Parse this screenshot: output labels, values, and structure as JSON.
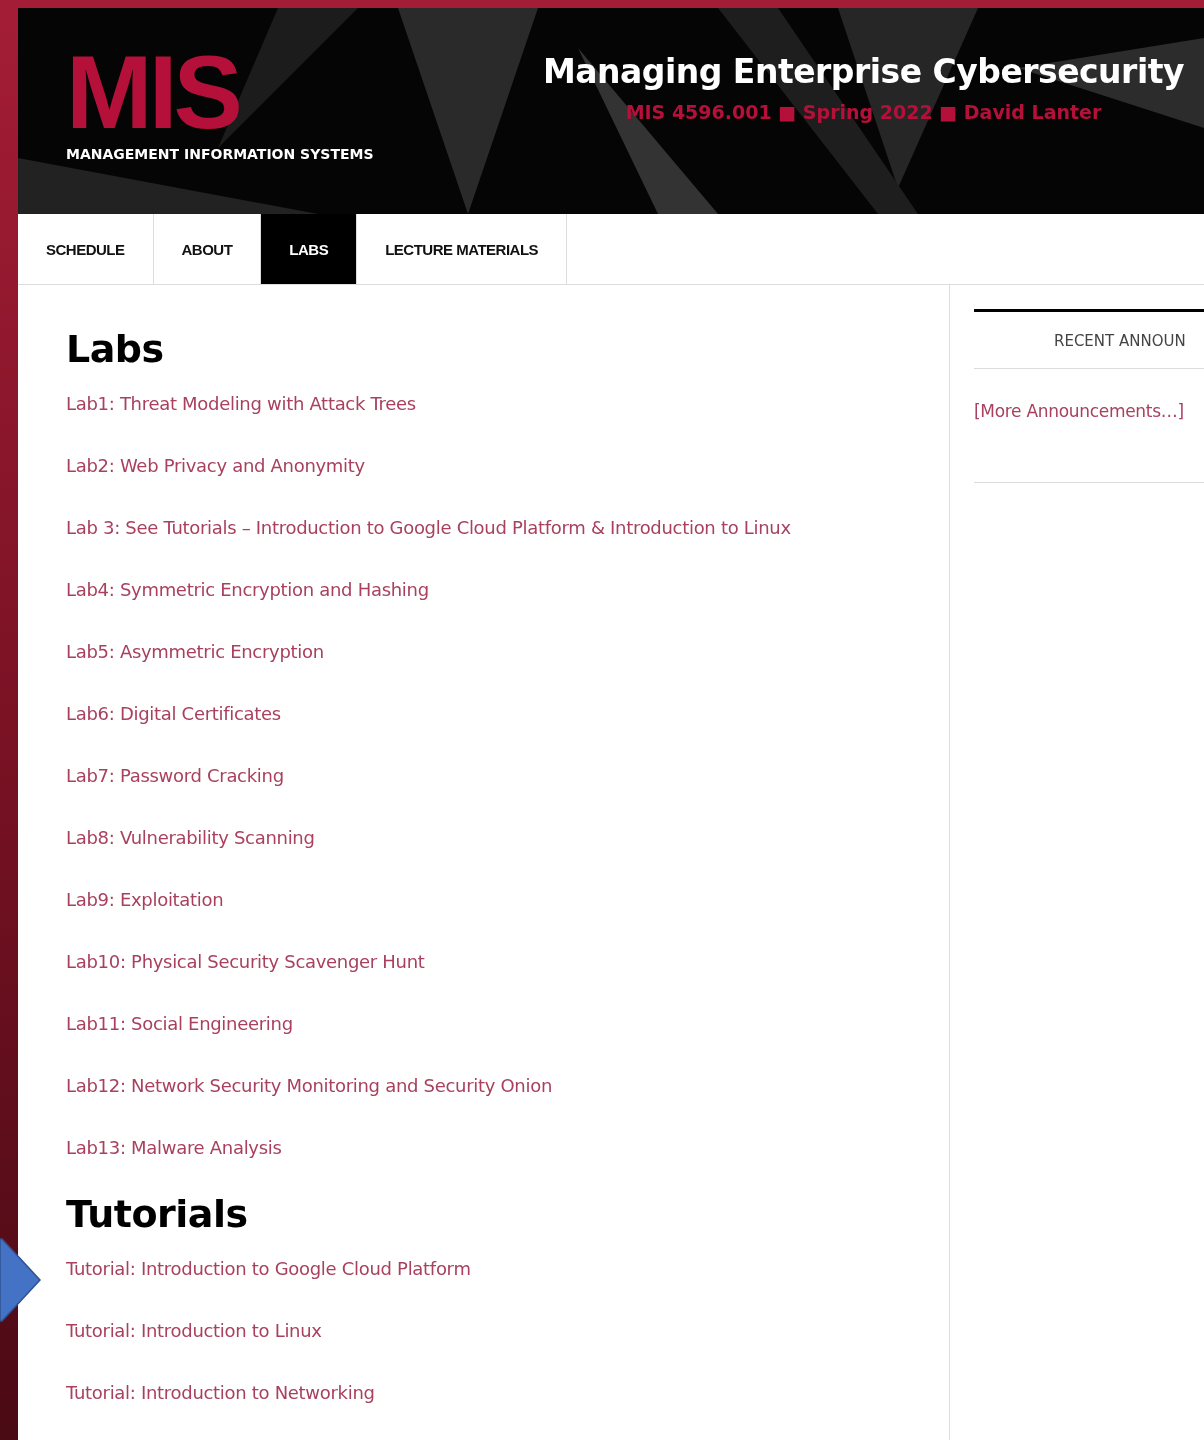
{
  "header": {
    "logo": "MIS",
    "logo_subtitle": "MANAGEMENT INFORMATION SYSTEMS",
    "title": "Managing Enterprise Cybersecurity",
    "subtitle": "MIS 4596.001 ■ Spring 2022 ■ David Lanter"
  },
  "nav": [
    {
      "label": "SCHEDULE",
      "selected": false
    },
    {
      "label": "ABOUT",
      "selected": false
    },
    {
      "label": "LABS",
      "selected": true
    },
    {
      "label": "LECTURE MATERIALS",
      "selected": false
    }
  ],
  "sections": [
    {
      "heading": "Labs",
      "links": [
        "Lab1: Threat Modeling with Attack Trees",
        "Lab2: Web Privacy and Anonymity",
        "Lab 3: See Tutorials – Introduction to Google Cloud Platform & Introduction to Linux",
        "Lab4: Symmetric Encryption and Hashing",
        "Lab5: Asymmetric Encryption",
        "Lab6: Digital Certificates",
        "Lab7: Password Cracking",
        "Lab8: Vulnerability Scanning",
        "Lab9: Exploitation",
        "Lab10: Physical Security Scavenger Hunt",
        "Lab11: Social Engineering",
        "Lab12: Network Security Monitoring and Security Onion",
        "Lab13: Malware Analysis"
      ]
    },
    {
      "heading": "Tutorials",
      "links": [
        "Tutorial: Introduction to Google Cloud Platform",
        "Tutorial: Introduction to Linux",
        "Tutorial: Introduction to Networking"
      ]
    }
  ],
  "sidebar": {
    "heading": "RECENT ANNOUN",
    "link": "[More Announcements…]"
  }
}
